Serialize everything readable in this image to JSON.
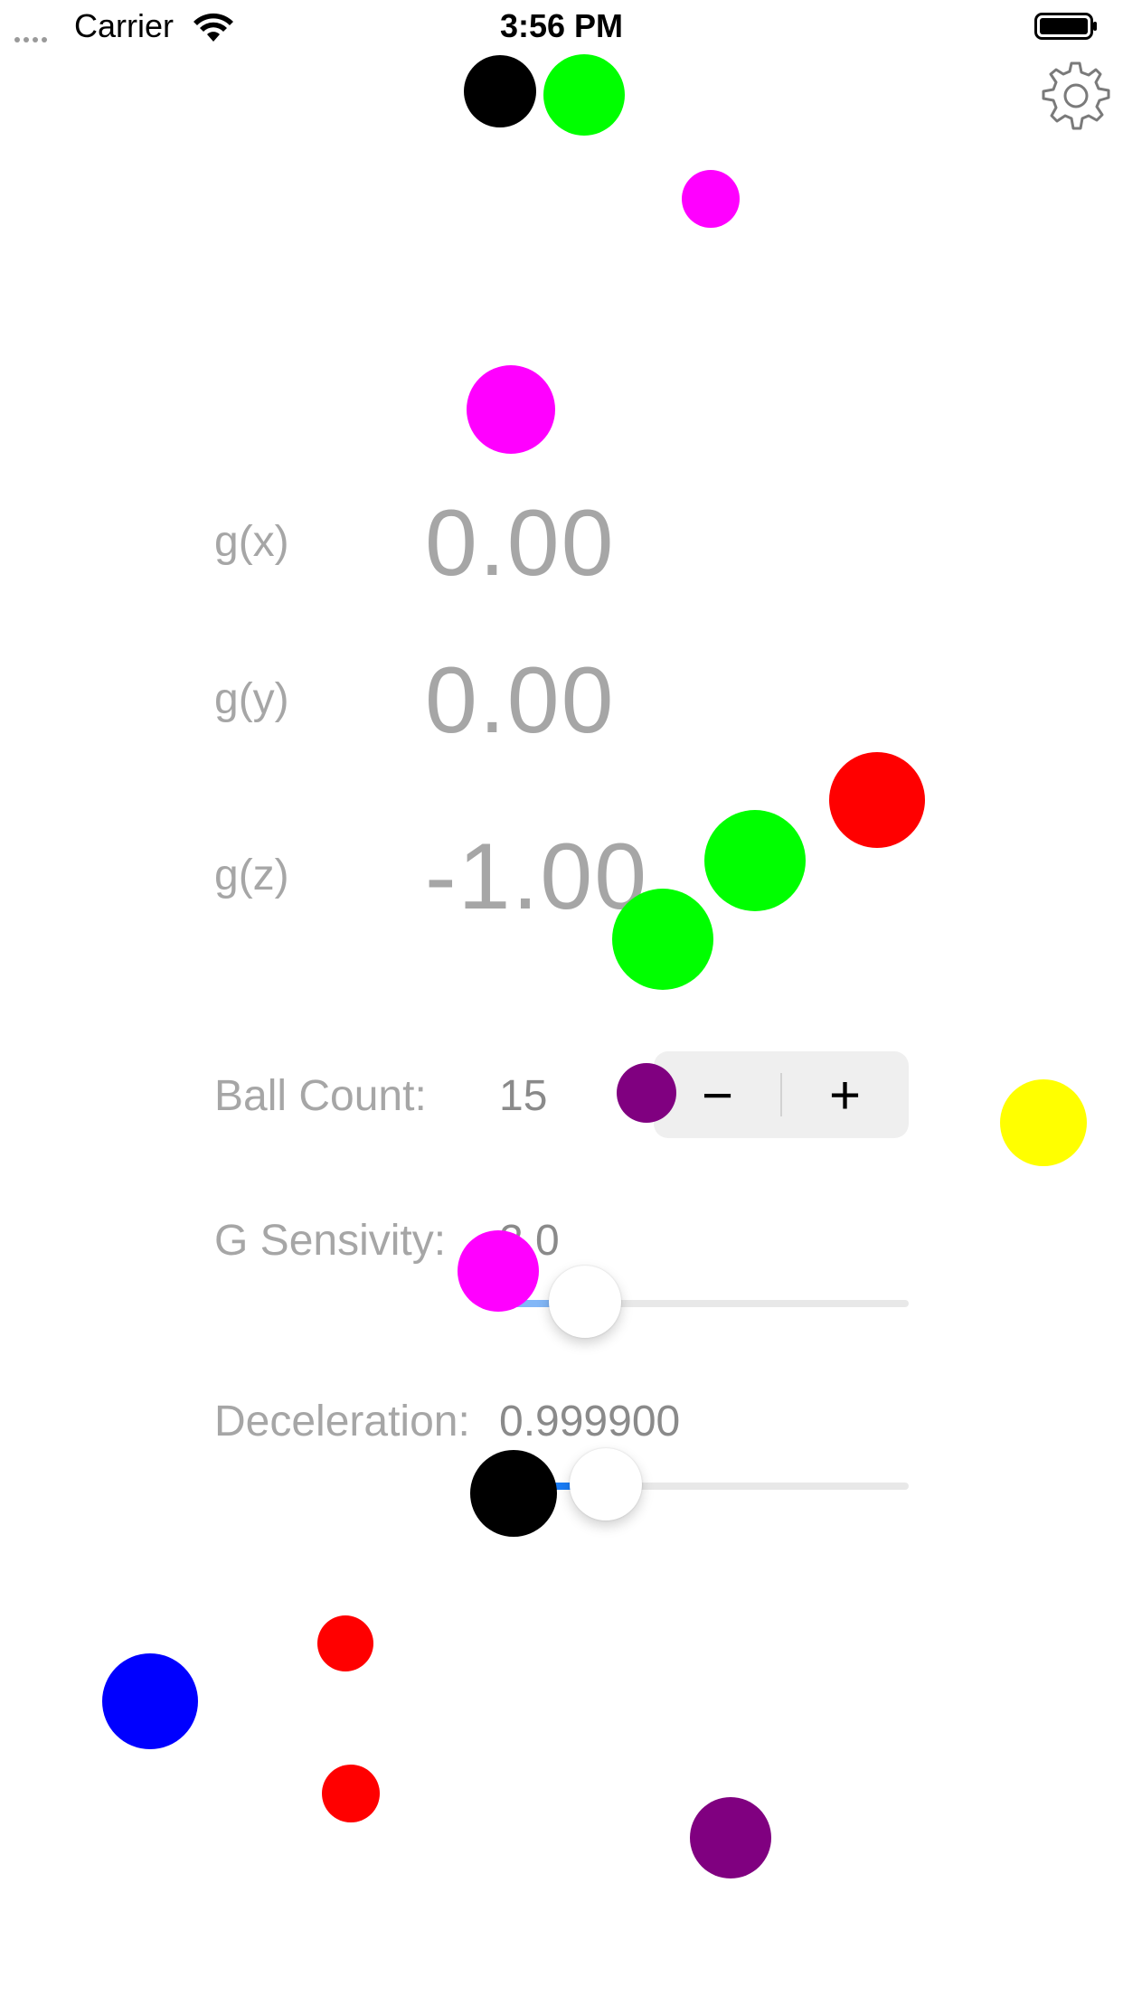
{
  "status_bar": {
    "carrier": "Carrier",
    "time": "3:56 PM"
  },
  "settings": {
    "icon": "gear-icon"
  },
  "gravity": {
    "x": {
      "label": "g(x)",
      "value": "0.00"
    },
    "y": {
      "label": "g(y)",
      "value": "0.00"
    },
    "z": {
      "label": "g(z)",
      "value": "-1.00"
    }
  },
  "ball_count": {
    "label": "Ball Count:",
    "value": "15",
    "minus_symbol": "−",
    "plus_symbol": "+"
  },
  "g_sensitivity": {
    "label": "G Sensivity:",
    "value": "2.0",
    "fill_fraction": 0.21
  },
  "deceleration": {
    "label": "Deceleration:",
    "value": "0.999900",
    "fill_fraction": 0.26
  },
  "colors": {
    "black": "#000000",
    "green": "#00ff00",
    "magenta": "#ff00ff",
    "red": "#ff0000",
    "yellow": "#ffff00",
    "purple": "#800080",
    "blue": "#0000ff",
    "slider_accent": "#1a7cf5"
  }
}
